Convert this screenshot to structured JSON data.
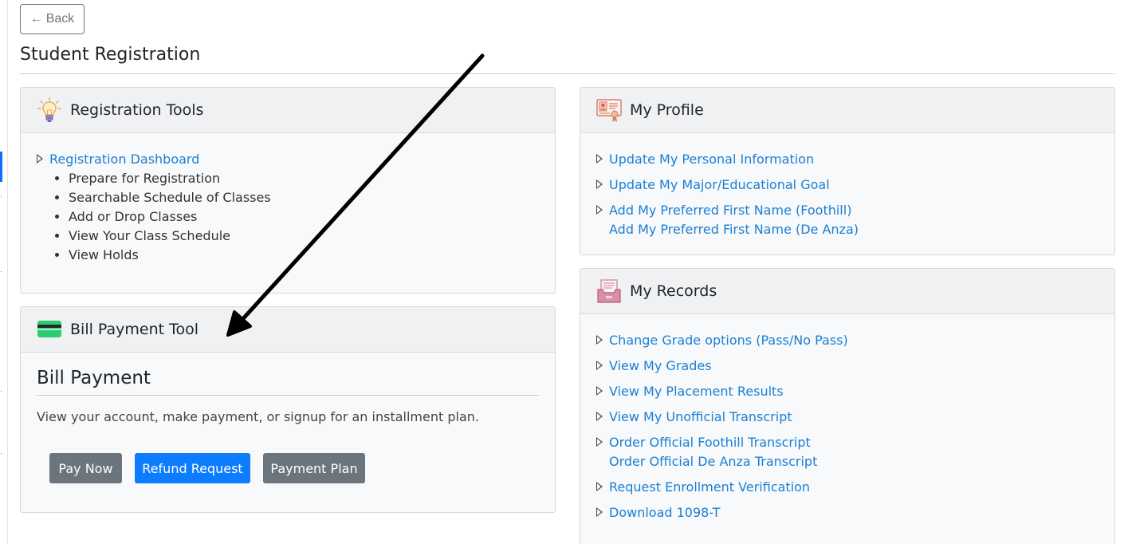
{
  "header": {
    "back_label": "Back",
    "page_title": "Student Registration"
  },
  "registration_tools": {
    "title": "Registration Tools",
    "icon": "lightbulb-icon",
    "dashboard_link": "Registration Dashboard",
    "items": [
      "Prepare for Registration",
      "Searchable Schedule of Classes",
      "Add or Drop Classes",
      "View Your Class Schedule",
      "View Holds"
    ]
  },
  "bill_payment": {
    "title": "Bill Payment Tool",
    "icon": "credit-card-icon",
    "heading": "Bill Payment",
    "description": "View your account, make payment, or signup for an installment plan.",
    "buttons": {
      "pay_now": "Pay Now",
      "refund_request": "Refund Request",
      "payment_plan": "Payment Plan"
    }
  },
  "my_profile": {
    "title": "My Profile",
    "icon": "id-card-icon",
    "links": [
      "Update My Personal Information",
      "Update My Major/Educational Goal",
      "Add My Preferred First Name (Foothill)",
      "Add My Preferred First Name (De Anza)"
    ]
  },
  "my_records": {
    "title": "My Records",
    "icon": "file-tray-icon",
    "links": [
      "Change Grade options (Pass/No Pass)",
      "View My Grades",
      "View My Placement Results",
      "View My Unofficial Transcript",
      "Order Official Foothill Transcript",
      "Order Official De Anza Transcript",
      "Request Enrollment Verification",
      "Download 1098-T"
    ]
  },
  "colors": {
    "link": "#1a7fd4",
    "primary_button": "#0d7cff",
    "secondary_button": "#6c757d",
    "panel_header": "#f0f1f2",
    "card_green": "#2ecc71"
  }
}
